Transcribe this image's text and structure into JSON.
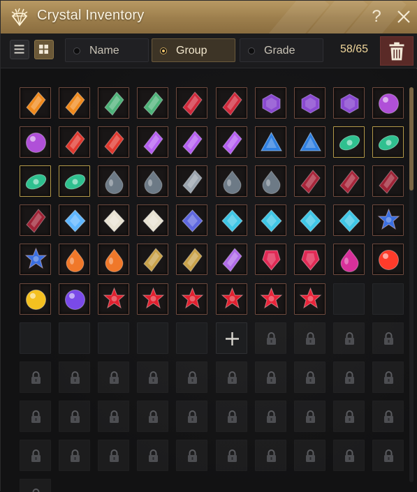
{
  "window": {
    "title": "Crystal Inventory",
    "title_icon": "diamond-icon",
    "help_label": "?",
    "close_icon": "close-icon"
  },
  "toolbar": {
    "view_buttons": [
      {
        "icon": "list-view-icon",
        "active": false
      },
      {
        "icon": "grid-view-icon",
        "active": true
      }
    ],
    "sort_tabs": [
      {
        "label": "Name",
        "selected": false
      },
      {
        "label": "Group",
        "selected": true
      },
      {
        "label": "Grade",
        "selected": false
      }
    ],
    "count": "58/65",
    "delete_icon": "trash-icon"
  },
  "inventory": {
    "columns": 10,
    "items": [
      {
        "name": "fire-shard-crystal",
        "color": "#f08a1e"
      },
      {
        "name": "fire-shard-crystal",
        "color": "#f08a1e"
      },
      {
        "name": "green-blue-ore-crystal",
        "color": "#4fb37a"
      },
      {
        "name": "green-blue-ore-crystal",
        "color": "#4fb37a"
      },
      {
        "name": "ruby-gem-crystal",
        "color": "#d02a3c"
      },
      {
        "name": "ruby-gem-crystal",
        "color": "#d02a3c"
      },
      {
        "name": "purple-hexagon-crystal",
        "color": "#8a4ad0"
      },
      {
        "name": "purple-hexagon-crystal",
        "color": "#8a4ad0"
      },
      {
        "name": "purple-hexagon-crystal",
        "color": "#8a4ad0"
      },
      {
        "name": "purple-orb-crystal",
        "color": "#b050d8"
      },
      {
        "name": "purple-orb-crystal",
        "color": "#b050d8"
      },
      {
        "name": "red-shard-crystal",
        "color": "#e0392f"
      },
      {
        "name": "red-shard-crystal",
        "color": "#e0392f"
      },
      {
        "name": "violet-shard-crystal",
        "color": "#b45ff0"
      },
      {
        "name": "violet-shard-crystal",
        "color": "#b45ff0"
      },
      {
        "name": "violet-shard-crystal",
        "color": "#b45ff0"
      },
      {
        "name": "blue-triangle-crystal",
        "color": "#2f7fe0"
      },
      {
        "name": "blue-triangle-crystal",
        "color": "#2f7fe0"
      },
      {
        "name": "emerald-eye-crystal",
        "color": "#2fc08f"
      },
      {
        "name": "emerald-eye-crystal",
        "color": "#2fc08f"
      },
      {
        "name": "emerald-eye-crystal",
        "color": "#2fc08f"
      },
      {
        "name": "emerald-eye-crystal",
        "color": "#2fc08f"
      },
      {
        "name": "dark-teardrop-crystal",
        "color": "#6d7a86"
      },
      {
        "name": "dark-teardrop-crystal",
        "color": "#6d7a86"
      },
      {
        "name": "ring-crystal",
        "color": "#9aa3ad"
      },
      {
        "name": "dark-teardrop-crystal",
        "color": "#6d7a86"
      },
      {
        "name": "dark-teardrop-crystal",
        "color": "#6d7a86"
      },
      {
        "name": "dark-ruby-cluster-crystal",
        "color": "#a8253a"
      },
      {
        "name": "dark-ruby-cluster-crystal",
        "color": "#a8253a"
      },
      {
        "name": "dark-ruby-crystal",
        "color": "#9e2336"
      },
      {
        "name": "dark-ruby-crystal",
        "color": "#9e2336"
      },
      {
        "name": "ice-diamond-crystal",
        "color": "#5fb6ff"
      },
      {
        "name": "white-diamond-crystal",
        "color": "#e8e2d2"
      },
      {
        "name": "white-diamond-crystal",
        "color": "#e8e2d2"
      },
      {
        "name": "indigo-diamond-crystal",
        "color": "#5f68e0"
      },
      {
        "name": "aqua-kite-crystal",
        "color": "#3fc6e6"
      },
      {
        "name": "aqua-kite-crystal",
        "color": "#3fc6e6"
      },
      {
        "name": "aqua-kite-crystal",
        "color": "#3fc6e6"
      },
      {
        "name": "aqua-kite-crystal",
        "color": "#3fc6e6"
      },
      {
        "name": "sapphire-star-crystal",
        "color": "#3a6fe0"
      },
      {
        "name": "sapphire-star-crystal",
        "color": "#3a6fe0"
      },
      {
        "name": "amber-drop-crystal",
        "color": "#f0782a"
      },
      {
        "name": "amber-drop-crystal",
        "color": "#f0782a"
      },
      {
        "name": "topaz-shard-crystal",
        "color": "#c9a24a"
      },
      {
        "name": "topaz-shard-crystal",
        "color": "#c9a24a"
      },
      {
        "name": "amethyst-shard-crystal",
        "color": "#b06be8"
      },
      {
        "name": "crimson-prism-crystal",
        "color": "#e02a55"
      },
      {
        "name": "crimson-prism-crystal",
        "color": "#e02a55"
      },
      {
        "name": "magenta-drop-crystal",
        "color": "#d8309a"
      },
      {
        "name": "red-sun-crystal",
        "color": "#ff3b2a"
      },
      {
        "name": "gold-orb-crystal",
        "color": "#f4c020"
      },
      {
        "name": "violet-orb-crystal",
        "color": "#7a4ae8"
      },
      {
        "name": "red-star-gem-crystal",
        "color": "#e0202f"
      },
      {
        "name": "red-star-gem-crystal",
        "color": "#e0202f"
      },
      {
        "name": "red-star-gem-crystal",
        "color": "#e0202f"
      },
      {
        "name": "red-star-gem-crystal",
        "color": "#e0202f"
      },
      {
        "name": "red-starburst-crystal",
        "color": "#e8243a"
      },
      {
        "name": "red-starburst-crystal",
        "color": "#e8243a"
      }
    ],
    "empty_slots": 7,
    "add_slot_icon": "plus-icon",
    "locked_slots": 35,
    "locked_icon": "lock-icon"
  }
}
